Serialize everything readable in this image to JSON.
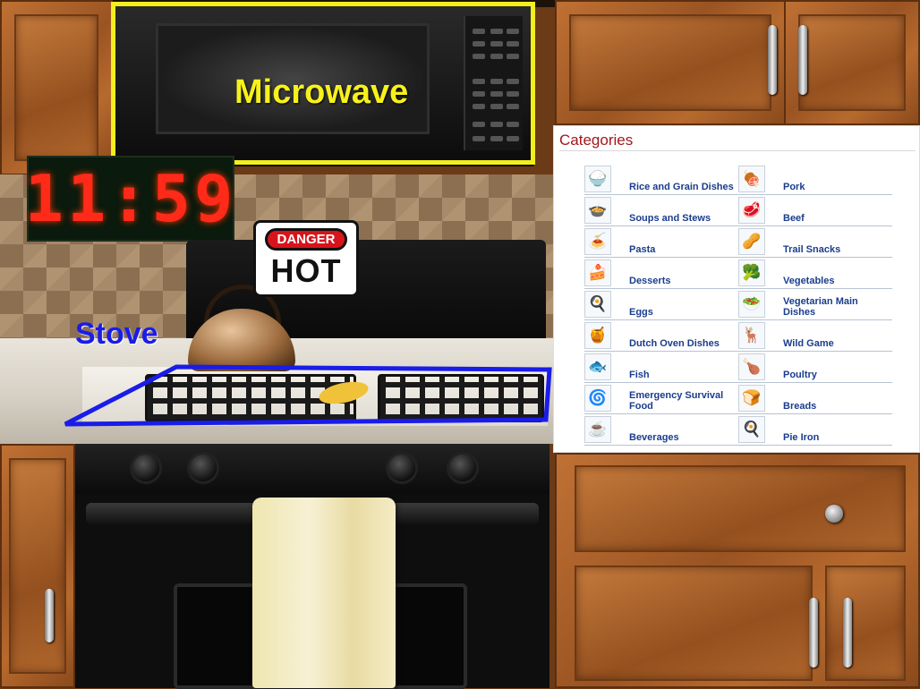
{
  "annotations": {
    "microwave_label": "Microwave",
    "stove_label": "Stove",
    "microwave_frame_color": "#f2ef1c",
    "stove_outline_color": "#1a1ce8"
  },
  "clock": {
    "time": "11:59",
    "color": "#ff2a1a"
  },
  "danger_sign": {
    "top": "DANGER",
    "main": "HOT"
  },
  "categories": {
    "title": "Categories",
    "rows": [
      [
        {
          "label": "Rice and Grain Dishes",
          "icon": "rice-bowl-icon",
          "glyph": "🍚"
        },
        {
          "label": "Pork",
          "icon": "pork-roast-icon",
          "glyph": "🍖"
        }
      ],
      [
        {
          "label": "Soups and Stews",
          "icon": "soup-bowl-icon",
          "glyph": "🍲"
        },
        {
          "label": "Beef",
          "icon": "steak-icon",
          "glyph": "🥩"
        }
      ],
      [
        {
          "label": "Pasta",
          "icon": "pasta-icon",
          "glyph": "🍝"
        },
        {
          "label": "Trail Snacks",
          "icon": "trail-mix-icon",
          "glyph": "🥜"
        }
      ],
      [
        {
          "label": "Desserts",
          "icon": "cake-icon",
          "glyph": "🍰"
        },
        {
          "label": "Vegetables",
          "icon": "vegetables-icon",
          "glyph": "🥦"
        }
      ],
      [
        {
          "label": "Eggs",
          "icon": "eggs-icon",
          "glyph": "🍳"
        },
        {
          "label": "Vegetarian Main Dishes",
          "icon": "salad-icon",
          "glyph": "🥗"
        }
      ],
      [
        {
          "label": "Dutch Oven Dishes",
          "icon": "dutch-oven-icon",
          "glyph": "🍯"
        },
        {
          "label": "Wild Game",
          "icon": "deer-icon",
          "glyph": "🦌"
        }
      ],
      [
        {
          "label": "Fish",
          "icon": "fish-icon",
          "glyph": "🐟"
        },
        {
          "label": "Poultry",
          "icon": "turkey-icon",
          "glyph": "🍗"
        }
      ],
      [
        {
          "label": "Emergency Survival Food",
          "icon": "survival-food-icon",
          "glyph": "🌀"
        },
        {
          "label": "Breads",
          "icon": "bread-icon",
          "glyph": "🍞"
        }
      ],
      [
        {
          "label": "Beverages",
          "icon": "beverage-mug-icon",
          "glyph": "☕"
        },
        {
          "label": "Pie Iron",
          "icon": "pie-iron-icon",
          "glyph": "🍳"
        }
      ]
    ]
  }
}
